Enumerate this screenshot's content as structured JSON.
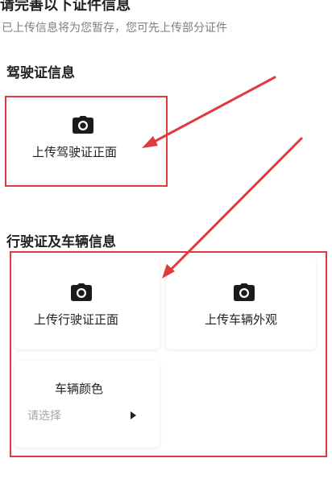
{
  "header": {
    "title": "请完善以下证件信息",
    "subtitle": "已上传信息将为您暂存，您可先上传部分证件"
  },
  "license_section": {
    "title": "驾驶证信息",
    "front_upload_label": "上传驾驶证正面"
  },
  "vehicle_section": {
    "title": "行驶证及车辆信息",
    "registration_front_label": "上传行驶证正面",
    "vehicle_exterior_label": "上传车辆外观",
    "color_field": {
      "label": "车辆颜色",
      "placeholder": "请选择"
    }
  },
  "annotation": {
    "color": "#e03a3f"
  },
  "icons": {
    "upload": "camera-icon",
    "select": "triangle-right-icon"
  }
}
